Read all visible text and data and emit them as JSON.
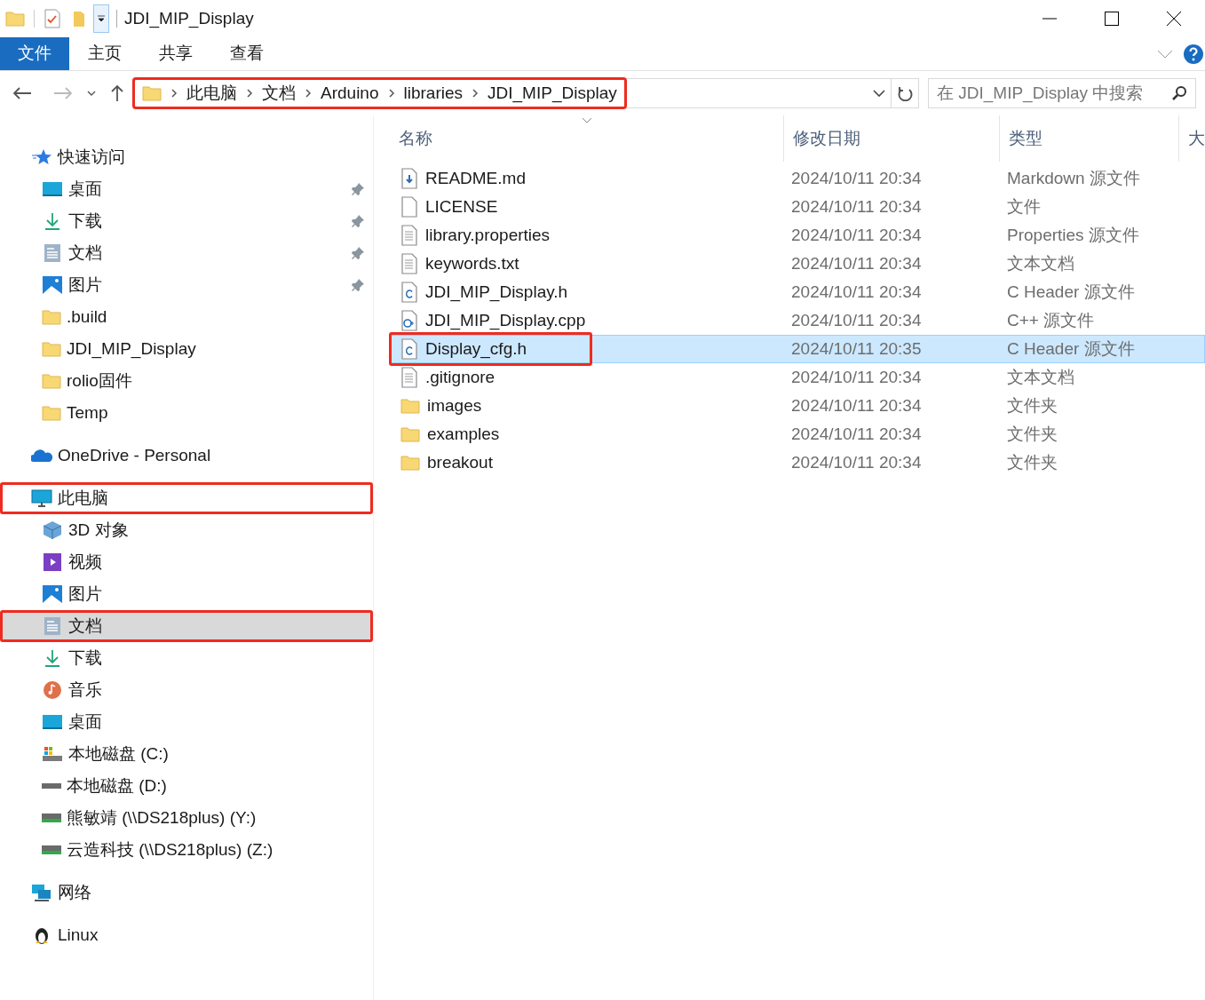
{
  "window": {
    "title": "JDI_MIP_Display"
  },
  "ribbon_tabs": [
    {
      "label": "文件",
      "kind": "file_menu"
    },
    {
      "label": "主页",
      "kind": "tab"
    },
    {
      "label": "共享",
      "kind": "tab"
    },
    {
      "label": "查看",
      "kind": "tab"
    }
  ],
  "address_bar": {
    "highlighted": true,
    "path": [
      "此电脑",
      "文档",
      "Arduino",
      "libraries",
      "JDI_MIP_Display"
    ]
  },
  "search": {
    "placeholder": "在 JDI_MIP_Display 中搜索"
  },
  "sidebar": {
    "items": [
      {
        "label": "快速访问",
        "kind": "star",
        "selected": false,
        "highlighted": false,
        "children": [
          {
            "label": "桌面",
            "kind": "desktop",
            "pinned": true,
            "selected": false,
            "highlighted": false
          },
          {
            "label": "下载",
            "kind": "download",
            "pinned": true,
            "selected": false,
            "highlighted": false
          },
          {
            "label": "文档",
            "kind": "documents",
            "pinned": true,
            "selected": false,
            "highlighted": false
          },
          {
            "label": "图片",
            "kind": "pictures",
            "pinned": true,
            "selected": false,
            "highlighted": false
          },
          {
            "label": ".build",
            "kind": "folder",
            "pinned": false,
            "selected": false,
            "highlighted": false
          },
          {
            "label": "JDI_MIP_Display",
            "kind": "folder",
            "pinned": false,
            "selected": false,
            "highlighted": false
          },
          {
            "label": "rolio固件",
            "kind": "folder",
            "pinned": false,
            "selected": false,
            "highlighted": false
          },
          {
            "label": "Temp",
            "kind": "folder",
            "pinned": false,
            "selected": false,
            "highlighted": false
          }
        ]
      },
      {
        "label": "OneDrive - Personal",
        "kind": "cloud",
        "selected": false,
        "highlighted": false
      },
      {
        "label": "此电脑",
        "kind": "pc",
        "selected": false,
        "highlighted": true,
        "children": [
          {
            "label": "3D 对象",
            "kind": "cube",
            "pinned": false,
            "selected": false,
            "highlighted": false
          },
          {
            "label": "视频",
            "kind": "video",
            "pinned": false,
            "selected": false,
            "highlighted": false
          },
          {
            "label": "图片",
            "kind": "pictures",
            "pinned": false,
            "selected": false,
            "highlighted": false
          },
          {
            "label": "文档",
            "kind": "documents",
            "pinned": false,
            "selected": true,
            "highlighted": true
          },
          {
            "label": "下载",
            "kind": "download",
            "pinned": false,
            "selected": false,
            "highlighted": false
          },
          {
            "label": "音乐",
            "kind": "music",
            "pinned": false,
            "selected": false,
            "highlighted": false
          },
          {
            "label": "桌面",
            "kind": "desktop",
            "pinned": false,
            "selected": false,
            "highlighted": false
          },
          {
            "label": "本地磁盘 (C:)",
            "kind": "system_drive",
            "pinned": false,
            "selected": false,
            "highlighted": false
          },
          {
            "label": "本地磁盘 (D:)",
            "kind": "drive",
            "pinned": false,
            "selected": false,
            "highlighted": false
          },
          {
            "label": "熊敏靖 (\\\\DS218plus) (Y:)",
            "kind": "net_drive",
            "pinned": false,
            "selected": false,
            "highlighted": false
          },
          {
            "label": "云造科技 (\\\\DS218plus) (Z:)",
            "kind": "net_drive",
            "pinned": false,
            "selected": false,
            "highlighted": false
          }
        ]
      },
      {
        "label": "网络",
        "kind": "network",
        "selected": false,
        "highlighted": false
      },
      {
        "label": "Linux",
        "kind": "penguin",
        "selected": false,
        "highlighted": false
      }
    ]
  },
  "table": {
    "columns": [
      "名称",
      "修改日期",
      "类型",
      "大"
    ],
    "rows": [
      {
        "name": "README.md",
        "kind": "markdown",
        "date": "2024/10/11 20:34",
        "type": "Markdown 源文件",
        "selected": false,
        "highlighted": false
      },
      {
        "name": "LICENSE",
        "kind": "blank",
        "date": "2024/10/11 20:34",
        "type": "文件",
        "selected": false,
        "highlighted": false
      },
      {
        "name": "library.properties",
        "kind": "text",
        "date": "2024/10/11 20:34",
        "type": "Properties 源文件",
        "selected": false,
        "highlighted": false
      },
      {
        "name": "keywords.txt",
        "kind": "text",
        "date": "2024/10/11 20:34",
        "type": "文本文档",
        "selected": false,
        "highlighted": false
      },
      {
        "name": "JDI_MIP_Display.h",
        "kind": "c_header",
        "date": "2024/10/11 20:34",
        "type": "C Header 源文件",
        "selected": false,
        "highlighted": false
      },
      {
        "name": "JDI_MIP_Display.cpp",
        "kind": "cpp",
        "date": "2024/10/11 20:34",
        "type": "C++ 源文件",
        "selected": false,
        "highlighted": false
      },
      {
        "name": "Display_cfg.h",
        "kind": "c_header",
        "date": "2024/10/11 20:35",
        "type": "C Header 源文件",
        "selected": true,
        "highlighted": true
      },
      {
        "name": ".gitignore",
        "kind": "text",
        "date": "2024/10/11 20:34",
        "type": "文本文档",
        "selected": false,
        "highlighted": false
      },
      {
        "name": "images",
        "kind": "folder",
        "date": "2024/10/11 20:34",
        "type": "文件夹",
        "selected": false,
        "highlighted": false
      },
      {
        "name": "examples",
        "kind": "folder",
        "date": "2024/10/11 20:34",
        "type": "文件夹",
        "selected": false,
        "highlighted": false
      },
      {
        "name": "breakout",
        "kind": "folder",
        "date": "2024/10/11 20:34",
        "type": "文件夹",
        "selected": false,
        "highlighted": false
      }
    ]
  }
}
